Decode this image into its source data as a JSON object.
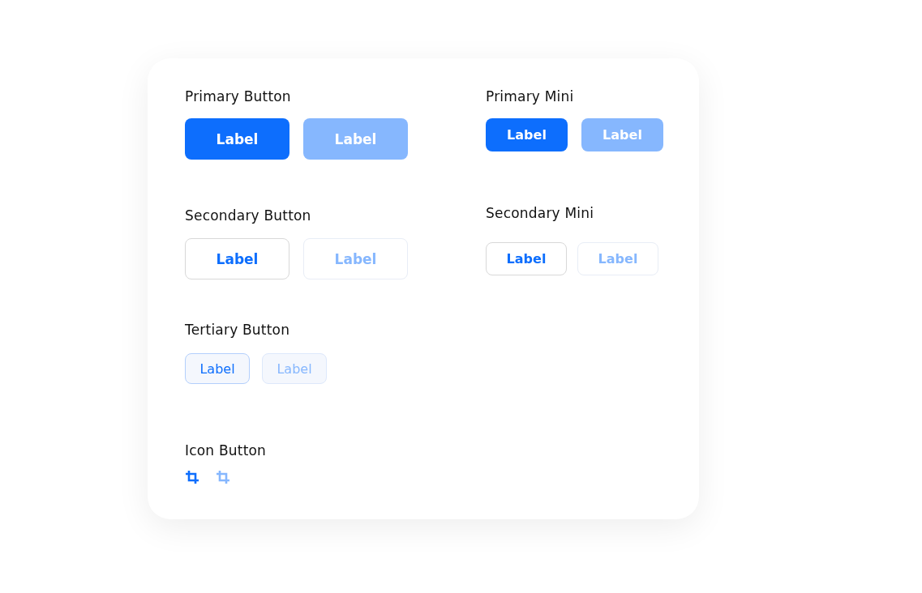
{
  "columns": [
    {
      "sections": [
        {
          "title": "Primary Button",
          "kind": "primary",
          "buttons": [
            {
              "label": "Label",
              "disabled": false
            },
            {
              "label": "Label",
              "disabled": true
            }
          ]
        },
        {
          "title": "Secondary Button",
          "kind": "secondary",
          "buttons": [
            {
              "label": "Label",
              "disabled": false
            },
            {
              "label": "Label",
              "disabled": true
            }
          ]
        },
        {
          "title": "Tertiary Button",
          "kind": "tertiary",
          "buttons": [
            {
              "label": "Label",
              "disabled": false
            },
            {
              "label": "Label",
              "disabled": true
            }
          ]
        },
        {
          "title": "Icon Button",
          "kind": "icon",
          "buttons": [
            {
              "disabled": false
            },
            {
              "disabled": true
            }
          ]
        }
      ]
    },
    {
      "sections": [
        {
          "title": "Primary Mini",
          "kind": "primary-mini",
          "buttons": [
            {
              "label": "Label",
              "disabled": false
            },
            {
              "label": "Label",
              "disabled": true
            }
          ]
        },
        {
          "title": "Secondary Mini",
          "kind": "secondary-mini",
          "buttons": [
            {
              "label": "Label",
              "disabled": false
            },
            {
              "label": "Label",
              "disabled": true
            }
          ]
        }
      ]
    }
  ]
}
